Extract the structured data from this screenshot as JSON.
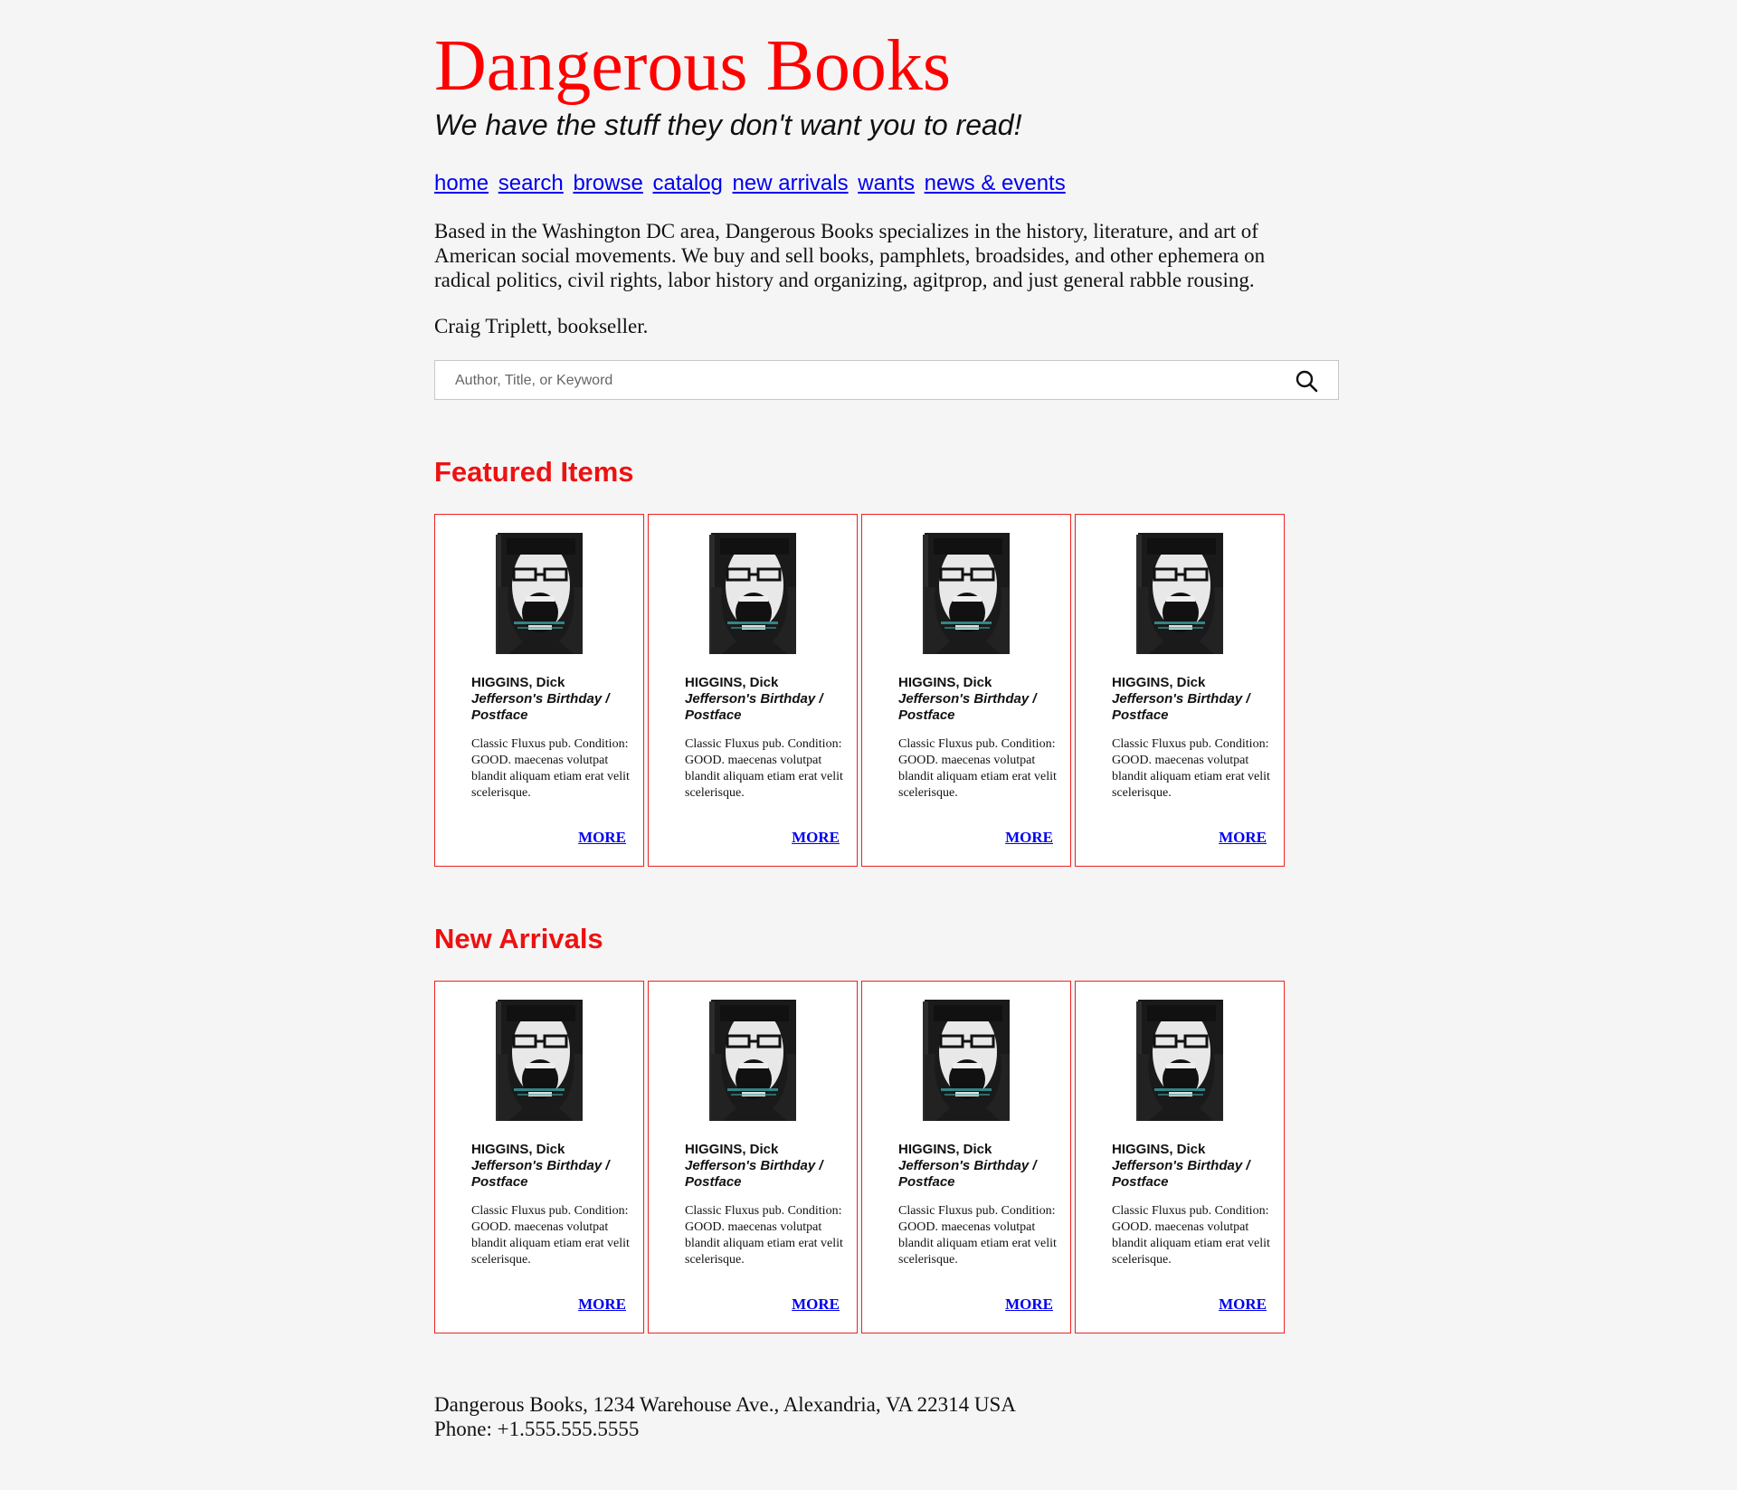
{
  "site": {
    "title": "Dangerous Books",
    "tagline": "We have the stuff they don't want you to read!"
  },
  "nav": [
    {
      "label": "home"
    },
    {
      "label": "search"
    },
    {
      "label": "browse"
    },
    {
      "label": "catalog"
    },
    {
      "label": "new arrivals"
    },
    {
      "label": "wants"
    },
    {
      "label": "news & events"
    }
  ],
  "intro": {
    "paragraph": "Based in the Washington DC area, Dangerous Books specializes in the history, literature, and art of American social movements. We buy and sell books, pamphlets, broadsides, and other ephemera on radical politics, civil rights, labor history and organizing, agitprop, and just general rabble rousing.",
    "bookseller": "Craig Triplett, bookseller."
  },
  "search": {
    "placeholder": "Author, Title, or Keyword",
    "value": "",
    "icon": "search-icon"
  },
  "featured": {
    "heading": "Featured Items",
    "items": [
      {
        "author": "HIGGINS, Dick",
        "title": "Jefferson's Birthday / Postface",
        "desc": "Classic Fluxus pub. Condition: GOOD. maecenas volutpat blandit aliquam etiam erat velit scelerisque.",
        "more": "MORE"
      },
      {
        "author": "HIGGINS, Dick",
        "title": "Jefferson's Birthday / Postface",
        "desc": "Classic Fluxus pub. Condition: GOOD. maecenas volutpat blandit aliquam etiam erat velit scelerisque.",
        "more": "MORE"
      },
      {
        "author": "HIGGINS, Dick",
        "title": "Jefferson's Birthday / Postface",
        "desc": "Classic Fluxus pub. Condition: GOOD. maecenas volutpat blandit aliquam etiam erat velit scelerisque.",
        "more": "MORE"
      },
      {
        "author": "HIGGINS, Dick",
        "title": "Jefferson's Birthday / Postface",
        "desc": "Classic Fluxus pub. Condition: GOOD. maecenas volutpat blandit aliquam etiam erat velit scelerisque.",
        "more": "MORE"
      }
    ]
  },
  "arrivals": {
    "heading": "New Arrivals",
    "items": [
      {
        "author": "HIGGINS, Dick",
        "title": "Jefferson's Birthday / Postface",
        "desc": "Classic Fluxus pub. Condition: GOOD. maecenas volutpat blandit aliquam etiam erat velit scelerisque.",
        "more": "MORE"
      },
      {
        "author": "HIGGINS, Dick",
        "title": "Jefferson's Birthday / Postface",
        "desc": "Classic Fluxus pub. Condition: GOOD. maecenas volutpat blandit aliquam etiam erat velit scelerisque.",
        "more": "MORE"
      },
      {
        "author": "HIGGINS, Dick",
        "title": "Jefferson's Birthday / Postface",
        "desc": "Classic Fluxus pub. Condition: GOOD. maecenas volutpat blandit aliquam etiam erat velit scelerisque.",
        "more": "MORE"
      },
      {
        "author": "HIGGINS, Dick",
        "title": "Jefferson's Birthday / Postface",
        "desc": "Classic Fluxus pub. Condition: GOOD. maecenas volutpat blandit aliquam etiam erat velit scelerisque.",
        "more": "MORE"
      }
    ]
  },
  "footer": {
    "address": "Dangerous Books, 1234 Warehouse Ave., Alexandria, VA 22314 USA",
    "phone": "Phone: +1.555.555.5555"
  },
  "colors": {
    "brand": "#ff0000",
    "link": "#0000ee",
    "background": "#f5f5f5",
    "card_border": "#ee2222"
  }
}
